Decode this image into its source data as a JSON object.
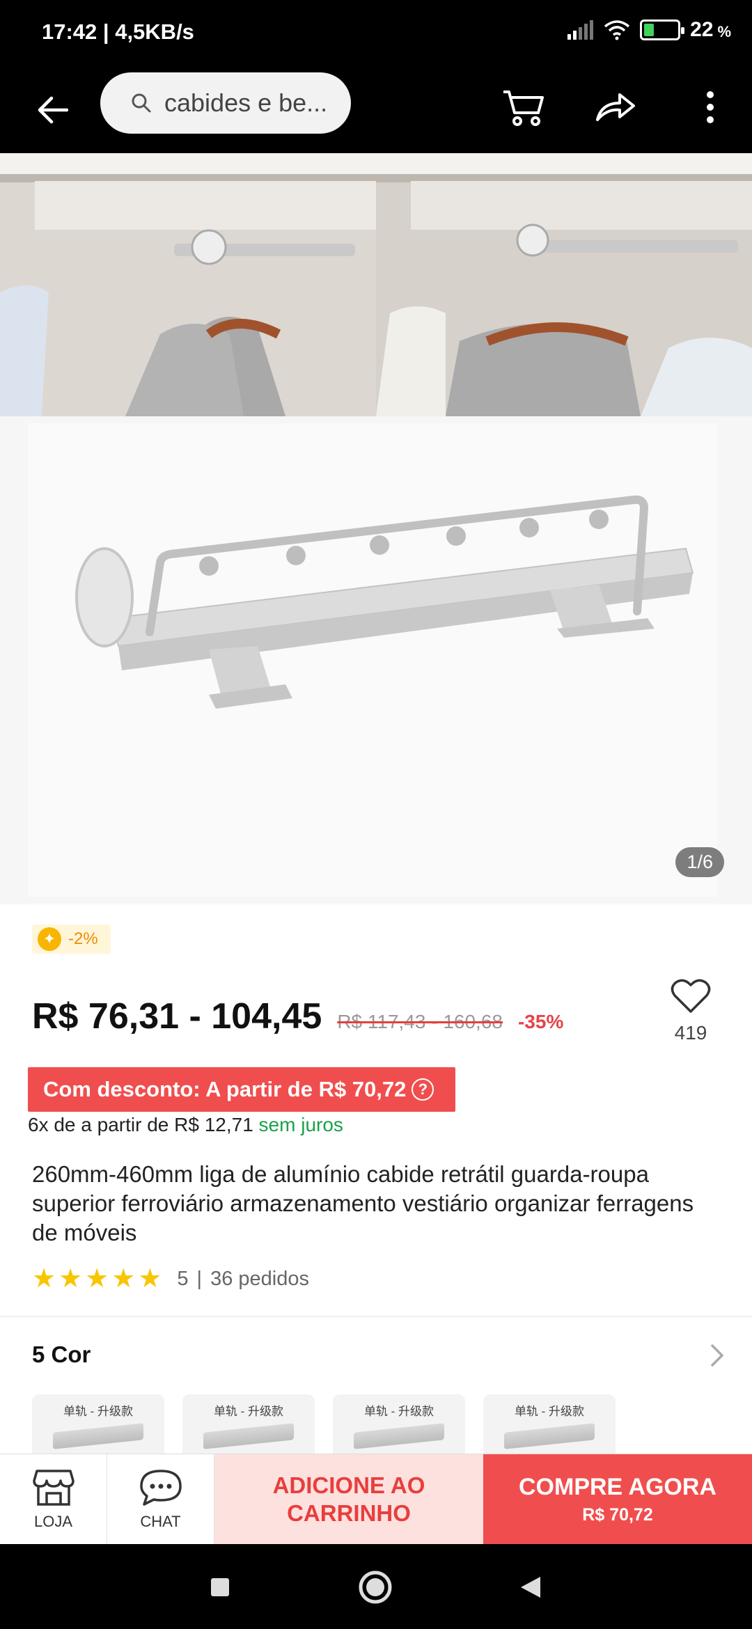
{
  "status": {
    "time": "17:42",
    "speed": "4,5KB/s",
    "battery": "22",
    "battery_unit": "%"
  },
  "nav": {
    "search_text": "cabides e be...",
    "back_icon": "arrow-left-icon",
    "cart_icon": "cart-icon",
    "share_icon": "share-icon",
    "more_icon": "more-vertical-icon"
  },
  "gallery": {
    "counter": "1/6"
  },
  "product": {
    "coin_badge": "-2%",
    "price": "R$ 76,31 - 104,45",
    "old_price": "R$ 117,43 - 160,68",
    "discount": "-35%",
    "wish_count": "419",
    "discount_banner": "Com desconto: A partir de R$ 70,72",
    "installment_prefix": "6x de a partir de R$ 12,71",
    "installment_suffix": "sem juros",
    "title": "260mm-460mm liga de alumínio cabide retrátil guarda-roupa superior ferroviário armazenamento vestiário organizar ferragens de móveis",
    "rating": "5",
    "orders": "36 pedidos"
  },
  "variants": {
    "header": "5 Cor",
    "items": [
      {
        "label": "单轨 - 升级款"
      },
      {
        "label": "单轨 - 升级款"
      },
      {
        "label": "单轨 - 升级款"
      },
      {
        "label": "单轨 - 升级款"
      }
    ],
    "more": "..."
  },
  "actions": {
    "store_label": "LOJA",
    "chat_label": "CHAT",
    "add_cart_label": "ADICIONE AO CARRINHO",
    "buy_label": "COMPRE AGORA",
    "buy_price": "R$ 70,72"
  },
  "colors": {
    "accent_red": "#f04e4e",
    "cart_bg": "#fde1de",
    "star": "#f7c600",
    "green": "#1aa14a"
  }
}
